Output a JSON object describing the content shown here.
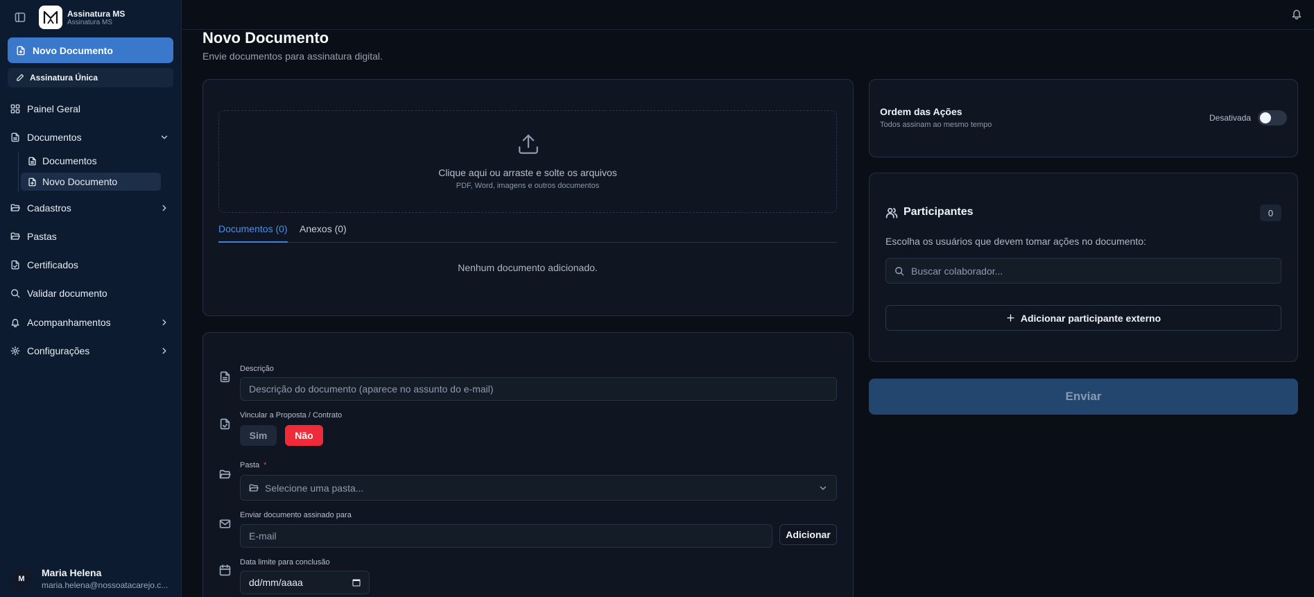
{
  "brand": {
    "name": "Assinatura MS",
    "subtitle": "Assinatura MS"
  },
  "sidebar": {
    "new_document": "Novo Documento",
    "single_signature": "Assinatura Única",
    "items": [
      {
        "label": "Painel Geral"
      },
      {
        "label": "Documentos"
      },
      {
        "label": "Cadastros"
      },
      {
        "label": "Pastas"
      },
      {
        "label": "Certificados"
      },
      {
        "label": "Validar documento"
      },
      {
        "label": "Acompanhamentos"
      },
      {
        "label": "Configurações"
      }
    ],
    "documents_sub": [
      {
        "label": "Documentos"
      },
      {
        "label": "Novo Documento"
      }
    ]
  },
  "user": {
    "initial": "M",
    "name": "Maria Helena",
    "email": "maria.helena@nossoatacarejo.c..."
  },
  "page": {
    "title": "Novo Documento",
    "subtitle": "Envie documentos para assinatura digital."
  },
  "upload": {
    "main_text": "Clique aqui ou arraste e solte os arquivos",
    "hint": "PDF, Word, imagens e outros documentos",
    "tabs": [
      {
        "label": "Documentos (0)",
        "active": true
      },
      {
        "label": "Anexos (0)",
        "active": false
      }
    ],
    "empty_message": "Nenhum documento adicionado."
  },
  "form": {
    "description": {
      "label": "Descrição",
      "placeholder": "Descrição do documento (aparece no assunto do e-mail)"
    },
    "link": {
      "label": "Vincular a Proposta / Contrato",
      "yes": "Sim",
      "no": "Não",
      "selected": "Não"
    },
    "folder": {
      "label": "Pasta",
      "required_mark": "*",
      "placeholder": "Selecione uma pasta..."
    },
    "send_signed": {
      "label": "Enviar documento assinado para",
      "placeholder": "E-mail",
      "button": "Adicionar"
    },
    "deadline": {
      "label": "Data limite para conclusão",
      "placeholder": "dd/mm/aaaa"
    }
  },
  "order": {
    "title": "Ordem das Ações",
    "subtitle": "Todos assinam ao mesmo tempo",
    "status": "Desativada",
    "enabled": false
  },
  "participants": {
    "title": "Participantes",
    "count": "0",
    "instruction": "Escolha os usuários que devem tomar ações no documento:",
    "search_placeholder": "Buscar colaborador...",
    "add_external": "Adicionar participante externo"
  },
  "submit": {
    "label": "Enviar"
  },
  "colors": {
    "accent": "#3a78cc",
    "danger": "#ef2b3a",
    "background": "#0a0f17",
    "sidebar": "#0d1b31"
  }
}
